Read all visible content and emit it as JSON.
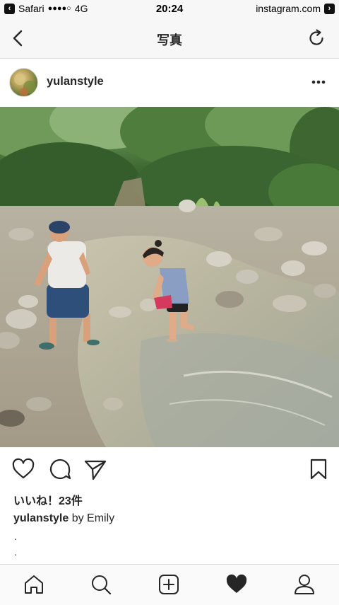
{
  "status_bar": {
    "back_app": "Safari",
    "signal": "●●●●○",
    "network": "4G",
    "time": "20:24",
    "url": "instagram.com"
  },
  "nav": {
    "title": "写真",
    "back_icon": "chevron-left-icon",
    "refresh_icon": "refresh-icon"
  },
  "post": {
    "username": "yulanstyle",
    "more_icon": "more-horizontal-icon",
    "likes": "いいね！23件",
    "caption_user": "yulanstyle",
    "caption_text": " by Emily",
    "dots": [
      ".",
      "."
    ]
  },
  "actions": {
    "like_icon": "heart-outline-icon",
    "comment_icon": "comment-icon",
    "share_icon": "send-icon",
    "save_icon": "bookmark-icon"
  },
  "tabs": [
    "home-icon",
    "search-icon",
    "add-icon",
    "heart-filled-icon",
    "profile-icon"
  ],
  "colors": {
    "text": "#262626",
    "bar_bg": "#f7f7f7",
    "border": "#dbdbdb"
  }
}
